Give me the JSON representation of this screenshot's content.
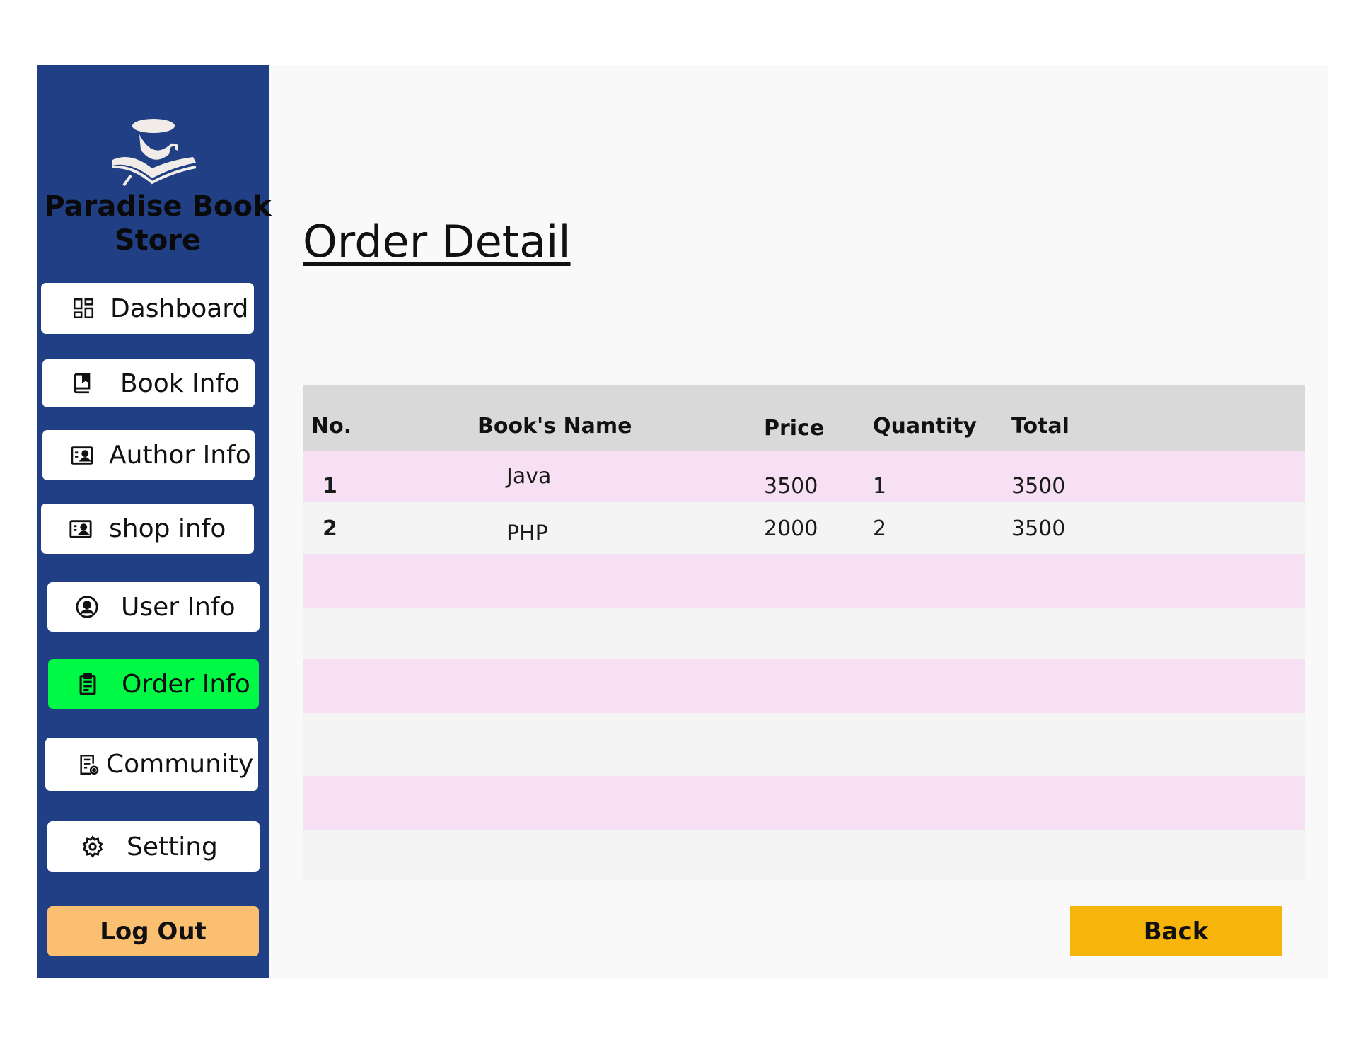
{
  "app": {
    "brand": "Paradise Book Store"
  },
  "sidebar": {
    "items": [
      {
        "label": "Dashboard",
        "icon": "dashboard-icon",
        "active": false
      },
      {
        "label": "Book Info",
        "icon": "book-icon",
        "active": false
      },
      {
        "label": "Author Info",
        "icon": "id-card-icon",
        "active": false
      },
      {
        "label": "shop info",
        "icon": "id-card-icon",
        "active": false
      },
      {
        "label": "User Info",
        "icon": "user-circle-icon",
        "active": false
      },
      {
        "label": "Order Info",
        "icon": "clipboard-icon",
        "active": true
      },
      {
        "label": "Community",
        "icon": "document-view-icon",
        "active": false
      },
      {
        "label": "Setting",
        "icon": "gear-icon",
        "active": false
      }
    ],
    "logout_label": "Log Out"
  },
  "main": {
    "title": "Order Detail",
    "table": {
      "headers": [
        "No.",
        "Book's Name",
        "Price",
        "Quantity",
        "Total"
      ],
      "rows": [
        {
          "no": "1",
          "name": "Java",
          "price": "3500",
          "quantity": "1",
          "total": "3500"
        },
        {
          "no": "2",
          "name": "PHP",
          "price": "2000",
          "quantity": "2",
          "total": "3500"
        }
      ]
    },
    "back_label": "Back"
  },
  "colors": {
    "sidebar_bg": "#213f85",
    "active_nav": "#00f945",
    "logout_bg": "#fbbf72",
    "back_bg": "#f7b50c",
    "header_bg": "#d9d9d9",
    "stripe_bg": "#f8e0f4"
  }
}
